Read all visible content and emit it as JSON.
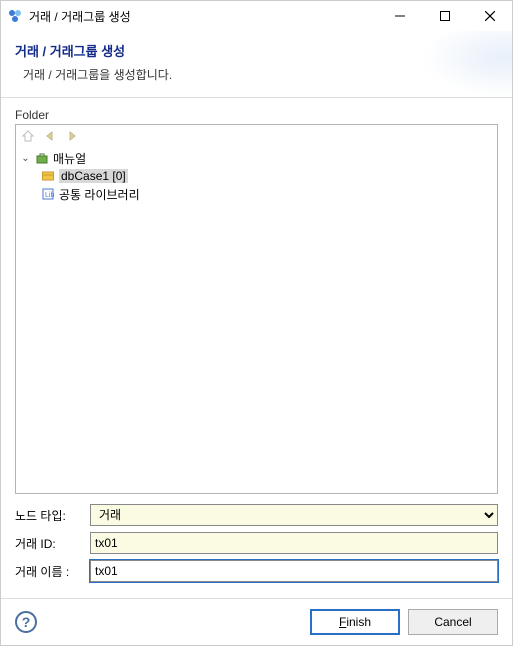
{
  "window": {
    "title": "거래 / 거래그룹 생성"
  },
  "header": {
    "title": "거래 / 거래그룹 생성",
    "subtitle": "거래 / 거래그룹을 생성합니다."
  },
  "folder": {
    "label": "Folder",
    "tree": {
      "root": {
        "label": "매뉴얼"
      },
      "child1": {
        "label": "dbCase1 [0]"
      },
      "child2": {
        "label": "공통 라이브러리"
      }
    }
  },
  "form": {
    "node_type": {
      "label": "노드 타입:",
      "value": "거래"
    },
    "tx_id": {
      "label": "거래 ID:",
      "value": "tx01"
    },
    "tx_name": {
      "label": "거래 이름  :",
      "value": "tx01"
    }
  },
  "footer": {
    "finish": "Finish",
    "cancel": "Cancel"
  }
}
